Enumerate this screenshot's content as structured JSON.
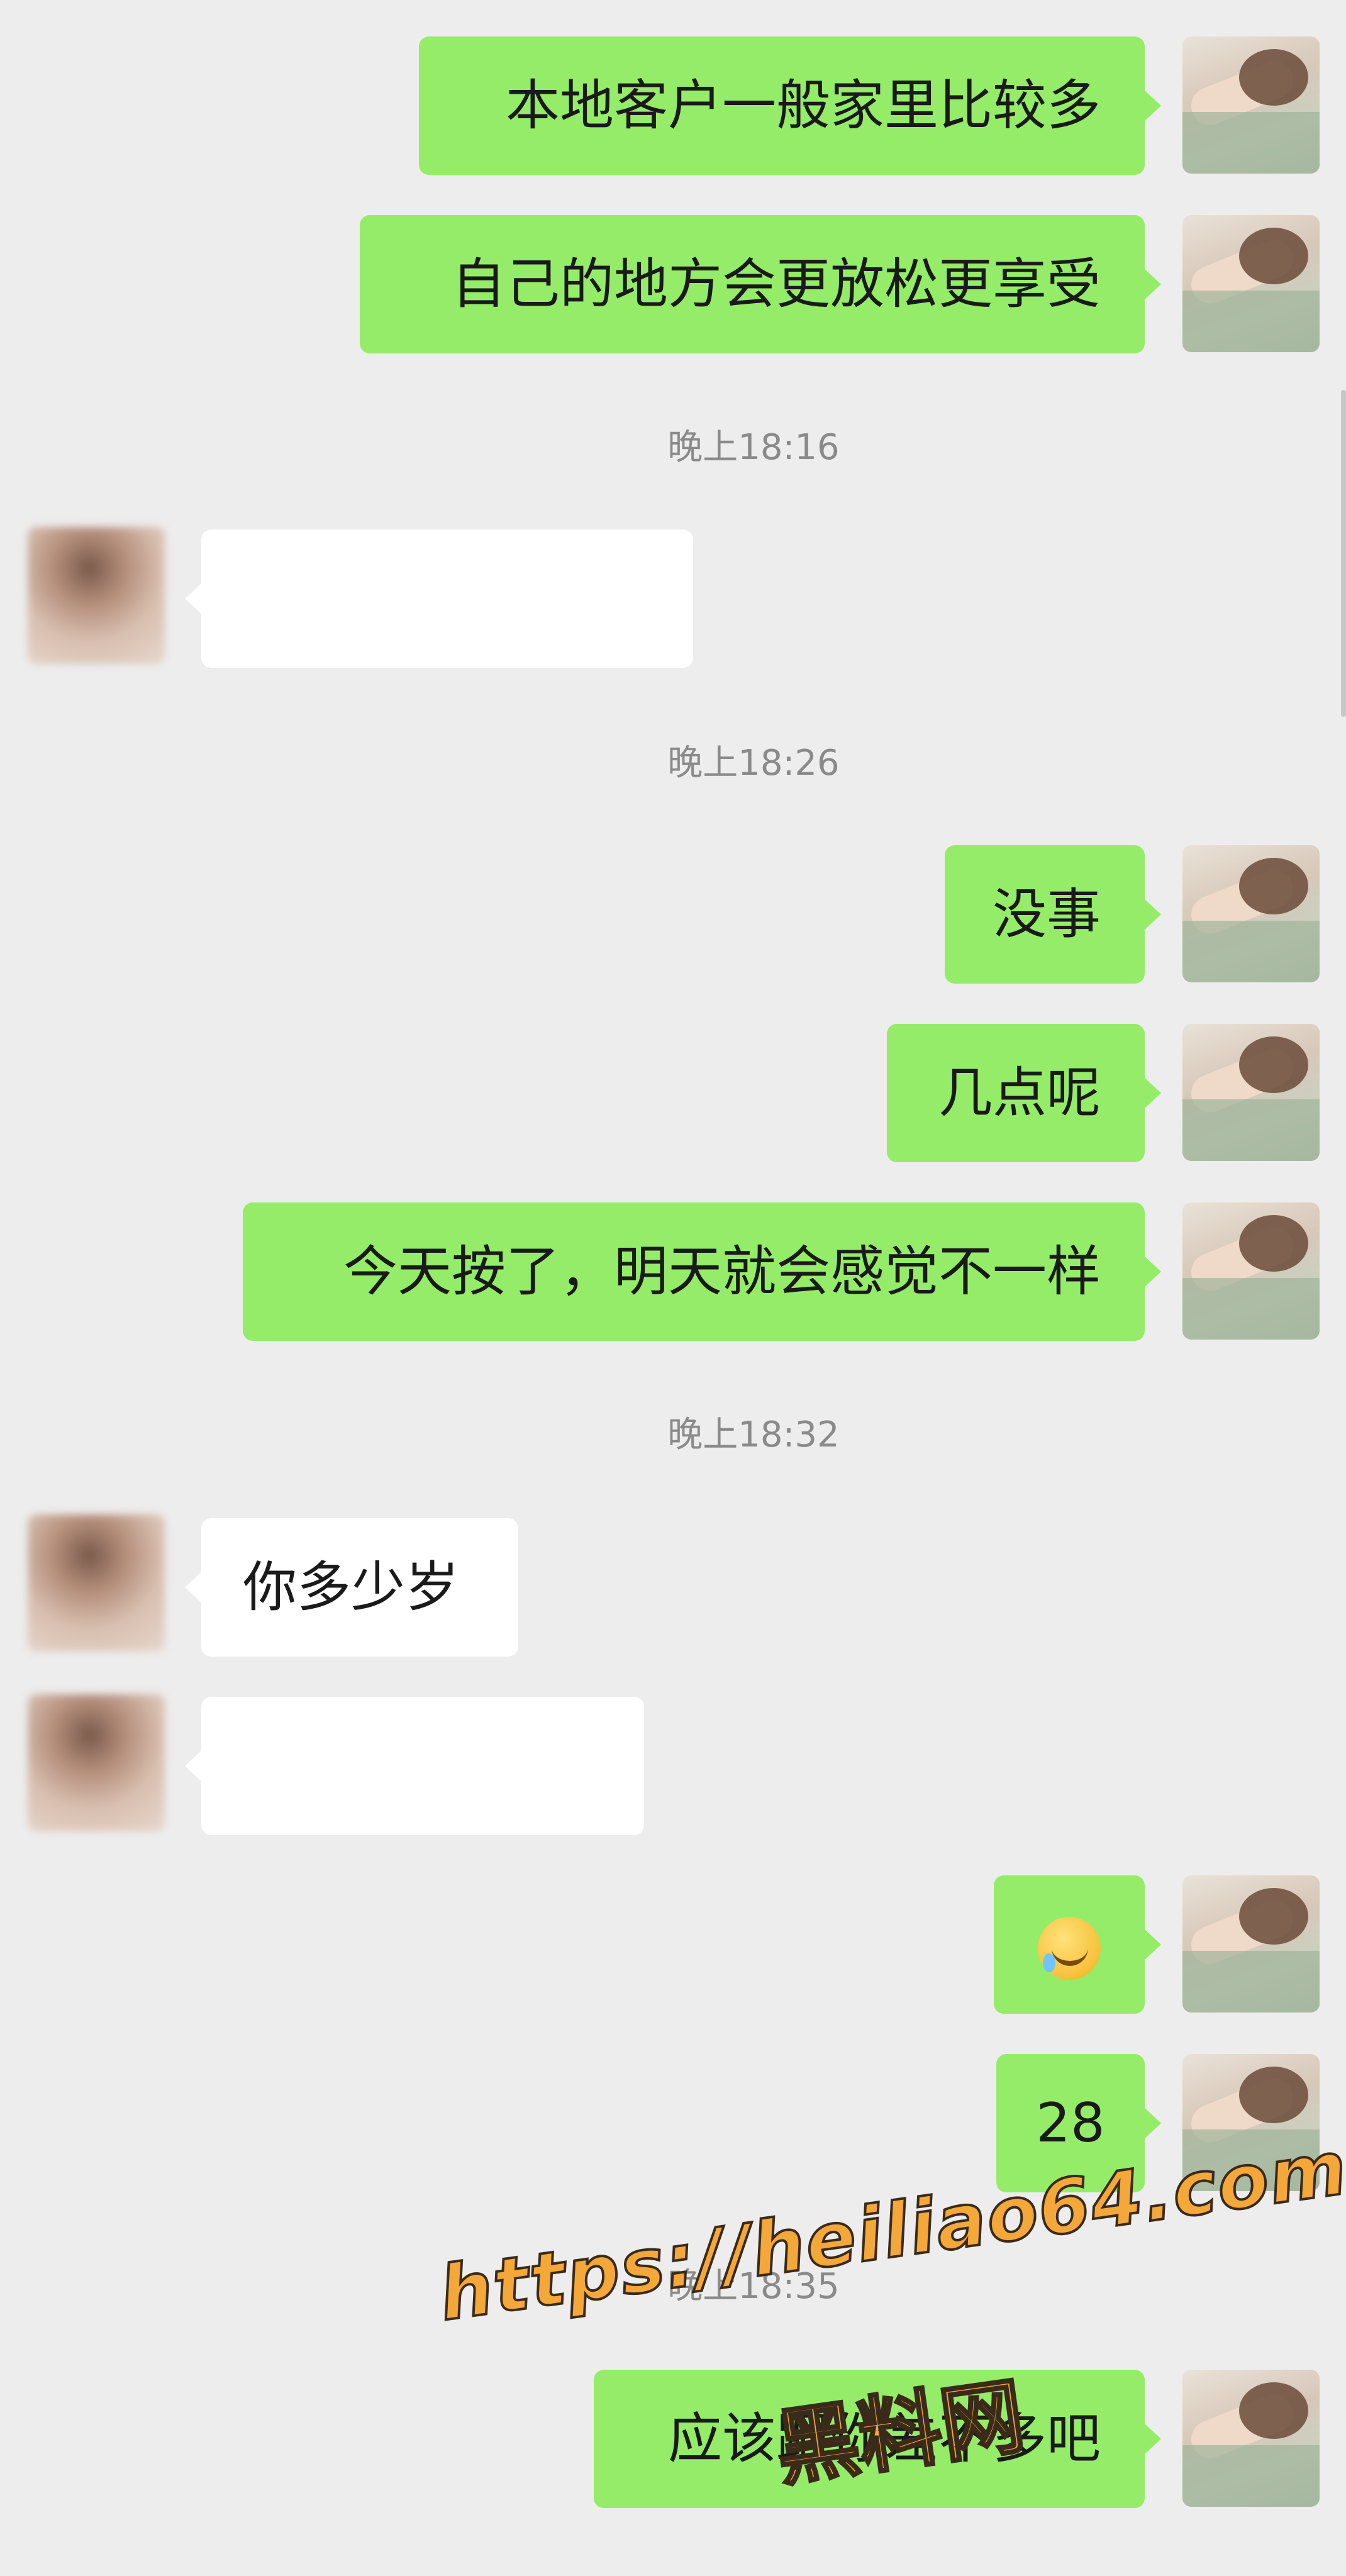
{
  "messages": [
    {
      "text": "本地客户一般家里比较多"
    },
    {
      "text": "自己的地方会更放松更享受"
    },
    {
      "text": "没事"
    },
    {
      "text": "几点呢"
    },
    {
      "text": "今天按了，明天就会感觉不一样"
    },
    {
      "text": "你多少岁"
    },
    {
      "text": "28"
    },
    {
      "text": "应该跟你差不多吧"
    }
  ],
  "timestamps": [
    "晚上18:16",
    "晚上18:26",
    "晚上18:32",
    "晚上18:35"
  ],
  "emoji_message": {
    "icon": "laughing-tears-emoji-icon"
  },
  "watermark": {
    "url": "https://heiliao64.com",
    "name": "黑料网"
  },
  "colors": {
    "outgoing_bubble": "#95ec69",
    "incoming_bubble": "#ffffff",
    "background": "#ededed",
    "watermark": "#f4a83a"
  }
}
